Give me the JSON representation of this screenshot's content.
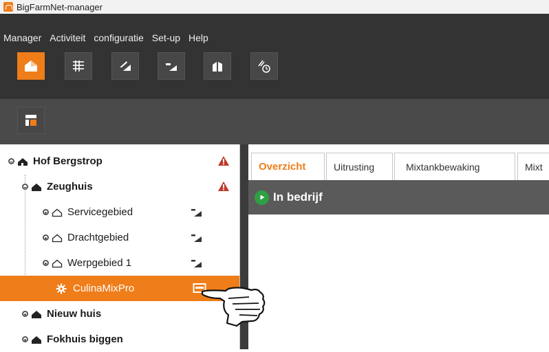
{
  "window": {
    "title": "BigFarmNet-manager"
  },
  "menu": [
    "Manager",
    "Activiteit",
    "configuratie",
    "Set-up",
    "Help"
  ],
  "toolbar": {
    "buttons": [
      "house-icon",
      "grid-icon",
      "unit-icon",
      "subunit-icon",
      "building-icon",
      "timer-icon"
    ]
  },
  "subbar": {
    "buttons": [
      "layout-icon"
    ]
  },
  "tree": {
    "items": [
      {
        "label": "Hof Bergstrop",
        "level": 0,
        "bold": true,
        "expander": "minus",
        "status": "warning"
      },
      {
        "label": "Zeughuis",
        "level": 1,
        "bold": true,
        "expander": "minus",
        "status": "warning"
      },
      {
        "label": "Servicegebied",
        "level": 2,
        "bold": false,
        "expander": "plus",
        "status": "unit"
      },
      {
        "label": "Drachtgebied",
        "level": 2,
        "bold": false,
        "expander": "plus",
        "status": "unit"
      },
      {
        "label": "Werpgebied 1",
        "level": 2,
        "bold": false,
        "expander": "plus",
        "status": "unit"
      },
      {
        "label": "CulinaMixPro",
        "level": 3,
        "bold": false,
        "expander": "none",
        "status": "panel",
        "selected": true
      },
      {
        "label": "Nieuw huis",
        "level": 1,
        "bold": true,
        "expander": "plus",
        "status": "none"
      },
      {
        "label": "Fokhuis biggen",
        "level": 1,
        "bold": true,
        "expander": "plus",
        "status": "none"
      }
    ]
  },
  "tabs": [
    "Overzicht",
    "Uitrusting",
    "Mixtankbewaking",
    "Mixt"
  ],
  "active_tab": "Overzicht",
  "status": {
    "text": "In bedrijf",
    "color": "#2ea043"
  },
  "colors": {
    "accent": "#ef7d1a",
    "warning": "#c0392b",
    "dark": "#333333"
  }
}
